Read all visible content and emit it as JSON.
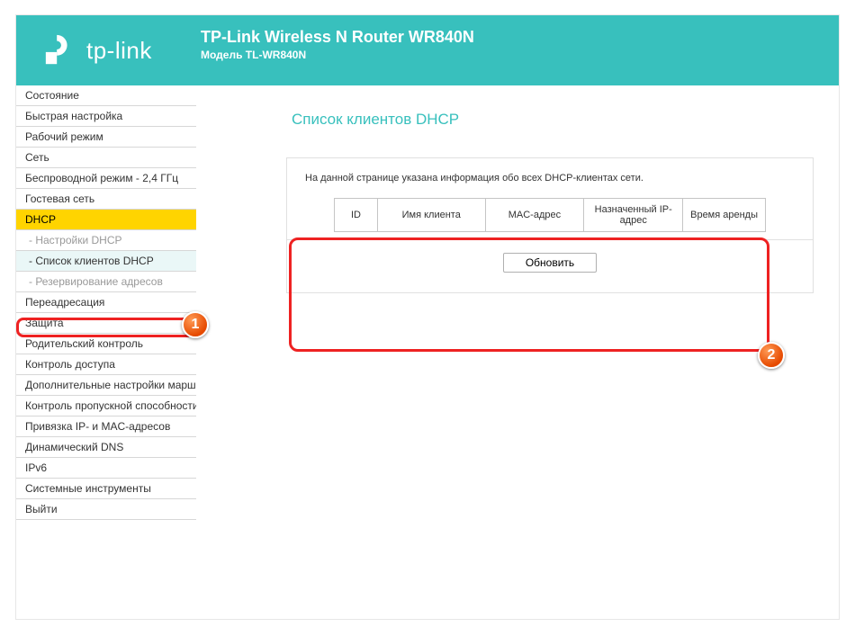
{
  "header": {
    "logo_text": "tp-link",
    "title": "TP-Link Wireless N Router WR840N",
    "subtitle": "Модель TL-WR840N"
  },
  "sidebar": {
    "items": [
      {
        "label": "Состояние",
        "cls": ""
      },
      {
        "label": "Быстрая настройка",
        "cls": ""
      },
      {
        "label": "Рабочий режим",
        "cls": ""
      },
      {
        "label": "Сеть",
        "cls": ""
      },
      {
        "label": "Беспроводной режим - 2,4 ГГц",
        "cls": ""
      },
      {
        "label": "Гостевая сеть",
        "cls": ""
      },
      {
        "label": "DHCP",
        "cls": "dhcp-parent"
      },
      {
        "label": "- Настройки DHCP",
        "cls": "child"
      },
      {
        "label": "- Список клиентов DHCP",
        "cls": "child active-child"
      },
      {
        "label": "- Резервирование адресов",
        "cls": "child"
      },
      {
        "label": "Переадресация",
        "cls": ""
      },
      {
        "label": "Защита",
        "cls": ""
      },
      {
        "label": "Родительский контроль",
        "cls": ""
      },
      {
        "label": "Контроль доступа",
        "cls": ""
      },
      {
        "label": "Дополнительные настройки маршрутизации",
        "cls": ""
      },
      {
        "label": "Контроль пропускной способности",
        "cls": ""
      },
      {
        "label": "Привязка IP- и MAC-адресов",
        "cls": ""
      },
      {
        "label": "Динамический DNS",
        "cls": ""
      },
      {
        "label": "IPv6",
        "cls": ""
      },
      {
        "label": "Системные инструменты",
        "cls": ""
      },
      {
        "label": "Выйти",
        "cls": ""
      }
    ]
  },
  "main": {
    "page_title": "Список клиентов DHCP",
    "note": "На данной странице указана информация обо всех DHCP-клиентах сети.",
    "columns": {
      "id": "ID",
      "name": "Имя клиента",
      "mac": "MAC-адрес",
      "ip": "Назначенный IP-адрес",
      "lease": "Время аренды"
    },
    "refresh_label": "Обновить"
  },
  "annotations": {
    "badge1": "1",
    "badge2": "2"
  }
}
